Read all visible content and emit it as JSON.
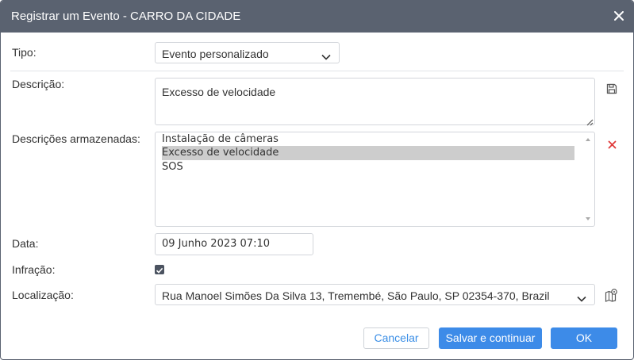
{
  "dialog": {
    "title": "Registrar um Evento - CARRO DA CIDADE",
    "close_icon": "close-icon"
  },
  "form": {
    "tipo": {
      "label": "Tipo:",
      "value": "Evento personalizado"
    },
    "descricao": {
      "label": "Descrição:",
      "value": "Excesso de velocidade",
      "save_icon": "save-icon"
    },
    "descricoes_armazenadas": {
      "label": "Descrições armazenadas:",
      "items": [
        "Instalação de câmeras",
        "Excesso de velocidade",
        "SOS"
      ],
      "selected_index": 1,
      "delete_icon": "delete-icon"
    },
    "data": {
      "label": "Data:",
      "value": "09 Junho 2023 07:10"
    },
    "infracao": {
      "label": "Infração:",
      "checked": true
    },
    "localizacao": {
      "label": "Localização:",
      "value": "Rua Manoel Simões Da Silva 13, Tremembé, São Paulo, SP 02354-370, Brazil",
      "map_icon": "map-pin-icon"
    }
  },
  "buttons": {
    "cancel": "Cancelar",
    "save_continue": "Salvar e continuar",
    "ok": "OK"
  },
  "colors": {
    "titlebar": "#5a6270",
    "primary": "#3d8be8",
    "delete": "#e03a3a",
    "selected_row": "#cdcdcd"
  }
}
